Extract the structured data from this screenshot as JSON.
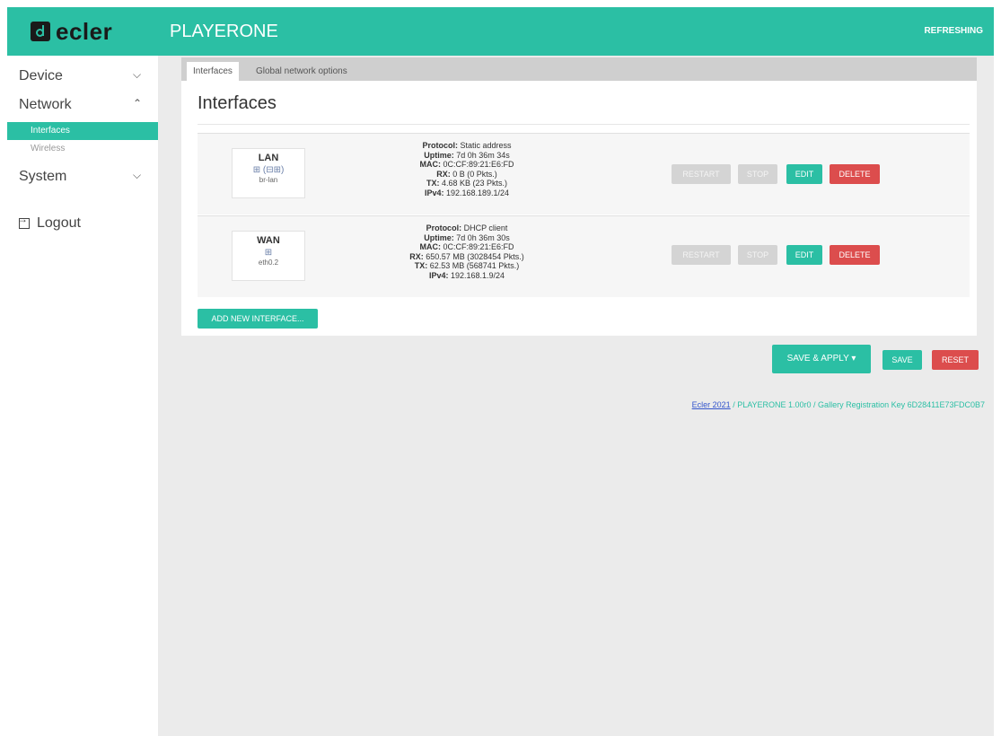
{
  "header": {
    "logo_text": "ecler",
    "title": "PLAYERONE",
    "status": "REFRESHING"
  },
  "sidebar": {
    "items": [
      {
        "label": "Device",
        "chevron": "v"
      },
      {
        "label": "Network",
        "chevron": "^"
      },
      {
        "label": "Interfaces"
      },
      {
        "label": "Wireless"
      },
      {
        "label": "System",
        "chevron": "v"
      }
    ],
    "logout": "Logout"
  },
  "tabs": [
    "Interfaces",
    "Global network options"
  ],
  "section_title": "Interfaces",
  "interfaces": [
    {
      "name": "LAN",
      "icon": "⊞ (⊟⊞)",
      "device": "br-lan",
      "protocol_label": "Protocol:",
      "protocol": "Static address",
      "uptime_label": "Uptime:",
      "uptime": "7d 0h 36m 34s",
      "mac_label": "MAC:",
      "mac": "0C:CF:89:21:E6:FD",
      "rx_label": "RX:",
      "rx": "0 B (0 Pkts.)",
      "tx_label": "TX:",
      "tx": "4.68 KB (23 Pkts.)",
      "ipv4_label": "IPv4:",
      "ipv4": "192.168.189.1/24"
    },
    {
      "name": "WAN",
      "icon": "⊞",
      "device": "eth0.2",
      "protocol_label": "Protocol:",
      "protocol": "DHCP client",
      "uptime_label": "Uptime:",
      "uptime": "7d 0h 36m 30s",
      "mac_label": "MAC:",
      "mac": "0C:CF:89:21:E6:FD",
      "rx_label": "RX:",
      "rx": "650.57 MB (3028454 Pkts.)",
      "tx_label": "TX:",
      "tx": "62.53 MB (568741 Pkts.)",
      "ipv4_label": "IPv4:",
      "ipv4": "192.168.1.9/24"
    }
  ],
  "buttons": {
    "restart": "RESTART",
    "stop": "STOP",
    "edit": "EDIT",
    "delete": "DELETE",
    "add_new": "ADD NEW INTERFACE...",
    "save_apply": "SAVE & APPLY ▾",
    "save": "SAVE",
    "reset": "RESET"
  },
  "footer": {
    "link": "Ecler 2021",
    "text": " / PLAYERONE 1.00r0 / Gallery Registration Key 6D28411E73FDC0B7"
  },
  "colors": {
    "accent": "#2bbfa4",
    "danger": "#dc4d4d"
  }
}
